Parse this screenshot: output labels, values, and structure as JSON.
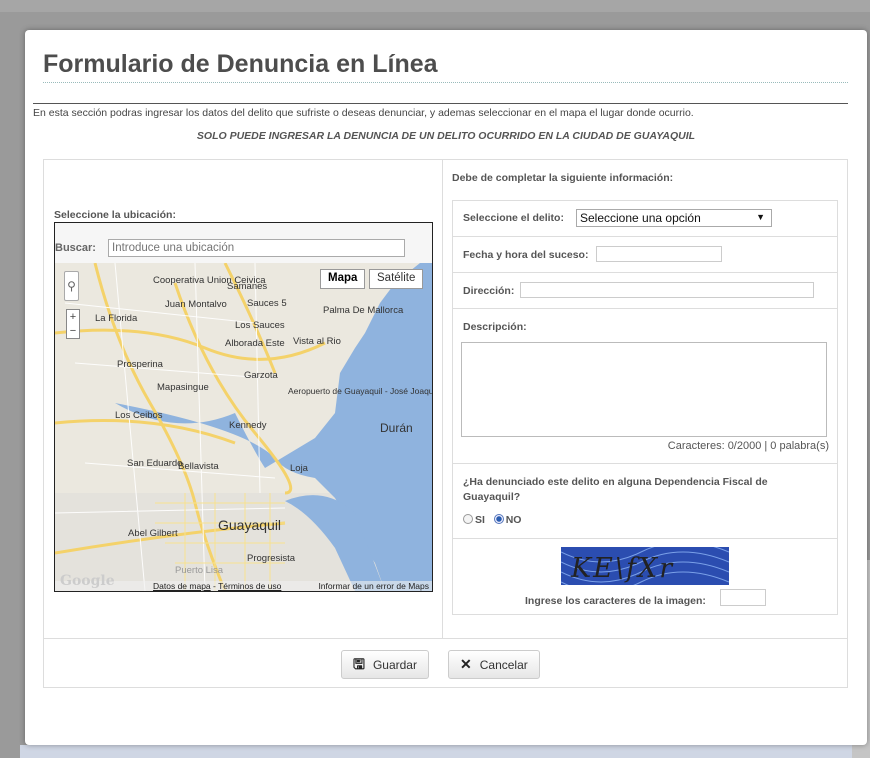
{
  "form": {
    "title": "Formulario de Denuncia en Línea",
    "intro": "En esta sección podras ingresar los datos del delito que sufriste o deseas denunciar, y ademas seleccionar en el mapa el lugar donde ocurrio.",
    "notice": "SOLO PUEDE INGRESAR LA DENUNCIA DE UN DELITO OCURRIDO EN LA CIUDAD DE GUAYAQUIL"
  },
  "map": {
    "section_label": "Seleccione la ubicación:",
    "search_label": "Buscar:",
    "search_placeholder": "Introduce una ubicación",
    "type_map": "Mapa",
    "type_satellite": "Satélite",
    "google_logo": "Google",
    "data_link": "Datos de mapa",
    "terms_link": "Términos de uso",
    "report_link": "Informar de un error de Maps",
    "places": [
      "Cooperativa Union Ceivica",
      "Samanes",
      "Juan Montalvo",
      "Sauces 5",
      "La Florida",
      "Los Sauces",
      "Palma De Mallorca",
      "Alborada Este",
      "Vista al Rio",
      "Prosperina",
      "Garzota",
      "Mapasingue",
      "Aeropuerto de Guayaquil - José Joaquín de Olmedo",
      "Los Ceibos",
      "Kennedy",
      "Durán",
      "San Eduardo",
      "Bellavista",
      "Loja",
      "Abel Gilbert",
      "Guayaquil",
      "Progresista",
      "Puerto Lisa"
    ]
  },
  "fields": {
    "header": "Debe de completar la siguiente información:",
    "crime_label": "Seleccione el delito:",
    "crime_value": "Seleccione una opción",
    "date_label": "Fecha y hora del suceso:",
    "date_value": "",
    "address_label": "Dirección:",
    "address_value": "",
    "description_label": "Descripción:",
    "description_value": "",
    "counter": "Caracteres: 0/2000 | 0 palabra(s)",
    "question": "¿Ha denunciado este delito en alguna Dependencia Fiscal de Guayaquil?",
    "option_yes": "SI",
    "option_no": "NO",
    "selected_option": "NO",
    "captcha_text": "KE\\fXr",
    "captcha_label": "Ingrese los caracteres de la imagen:",
    "captcha_value": ""
  },
  "buttons": {
    "save": "Guardar",
    "cancel": "Cancelar"
  },
  "colors": {
    "river": "#8fb3de",
    "road_yellow": "#f4d26a",
    "land": "#eceae3"
  }
}
